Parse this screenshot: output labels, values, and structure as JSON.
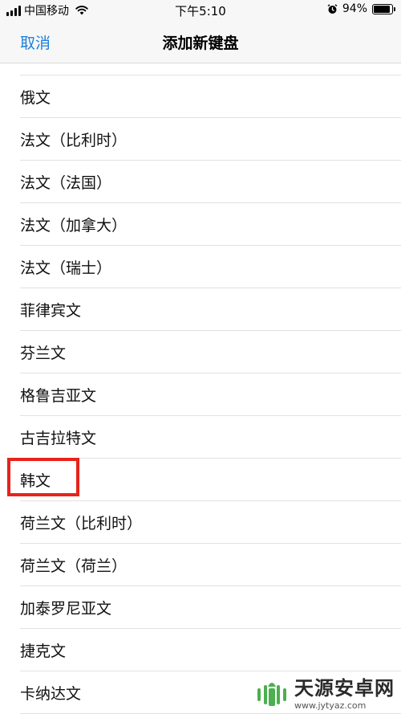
{
  "status_bar": {
    "carrier": "中国移动",
    "time": "下午5:10",
    "battery_text": "94%",
    "battery_level": 0.94
  },
  "nav": {
    "cancel_label": "取消",
    "title": "添加新键盘"
  },
  "list": {
    "items": [
      {
        "label": "俄文"
      },
      {
        "label": "法文（比利时）"
      },
      {
        "label": "法文（法国）"
      },
      {
        "label": "法文（加拿大）"
      },
      {
        "label": "法文（瑞士）"
      },
      {
        "label": "菲律宾文"
      },
      {
        "label": "芬兰文"
      },
      {
        "label": "格鲁吉亚文"
      },
      {
        "label": "古吉拉特文"
      },
      {
        "label": "韩文"
      },
      {
        "label": "荷兰文（比利时）"
      },
      {
        "label": "荷兰文（荷兰）"
      },
      {
        "label": "加泰罗尼亚文"
      },
      {
        "label": "捷克文"
      },
      {
        "label": "卡纳达文"
      }
    ]
  },
  "watermark": {
    "title": "天源安卓网",
    "url": "www.jytyaz.com"
  },
  "colors": {
    "accent": "#1a7fe0",
    "highlight": "#e8231a"
  }
}
